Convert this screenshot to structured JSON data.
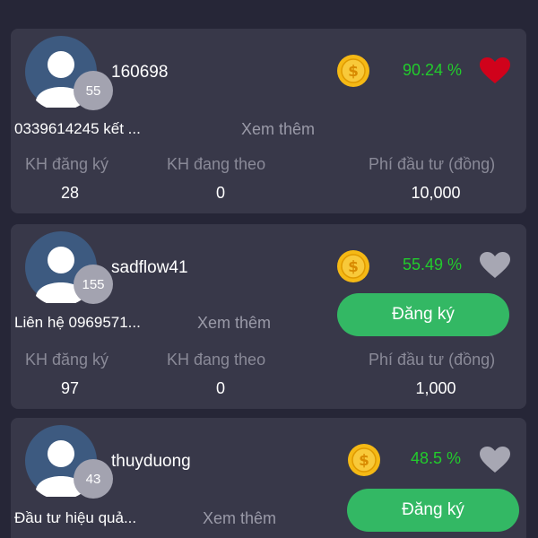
{
  "colors": {
    "background": "#262637",
    "card": "#383849",
    "percent_green": "#22cc2c",
    "button_green": "#33b864",
    "heart_liked": "#d0021b",
    "heart_unliked": "#a7a7b3",
    "coin_gold": "#f5b915"
  },
  "icons": {
    "avatar": "default-user-avatar-icon",
    "coin": "gold-coin-icon",
    "favorite": "heart-icon"
  },
  "stat_labels": {
    "subscribed": "KH đăng ký",
    "following": "KH đang theo",
    "fee": "Phí đầu tư (đồng)"
  },
  "cards": [
    {
      "level": "55",
      "username": "160698",
      "percent": "90.24 %",
      "liked": true,
      "description": "0339614245 kết ...",
      "more_label": "Xem thêm",
      "subscribe_label": "",
      "subscribed_count": "28",
      "following_count": "0",
      "fee": "10,000"
    },
    {
      "level": "155",
      "username": "sadflow41",
      "percent": "55.49 %",
      "liked": false,
      "description": "Liên hệ 0969571...",
      "more_label": "Xem thêm",
      "subscribe_label": "Đăng ký",
      "subscribed_count": "97",
      "following_count": "0",
      "fee": "1,000"
    },
    {
      "level": "43",
      "username": "thuyduong",
      "percent": "48.5 %",
      "liked": false,
      "description": "Đầu tư hiệu quả...",
      "more_label": "Xem thêm",
      "subscribe_label": "Đăng ký"
    }
  ]
}
